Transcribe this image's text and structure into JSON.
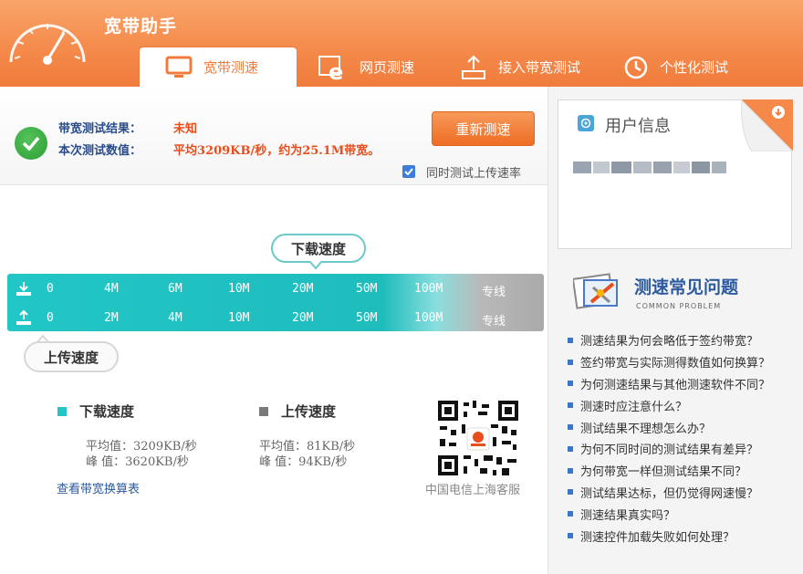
{
  "app": {
    "title": "宽带助手"
  },
  "tabs": [
    {
      "label": "宽带测速",
      "icon": "monitor-icon",
      "active": true
    },
    {
      "label": "网页测速",
      "icon": "browser-e-icon",
      "active": false
    },
    {
      "label": "接入带宽测试",
      "icon": "router-icon",
      "active": false
    },
    {
      "label": "个性化测试",
      "icon": "clock-icon",
      "active": false
    }
  ],
  "result": {
    "result_label": "带宽测试结果：",
    "result_value": "未知",
    "value_label": "本次测试数值：",
    "value_text": "平均3209KB/秒，约为25.1M带宽。",
    "retest_button": "重新测速",
    "upload_checkbox_label": "同时测试上传速率",
    "upload_checked": true
  },
  "speed_bar": {
    "download_label": "下载速度",
    "upload_label": "上传速度",
    "download_ticks": [
      "0",
      "4M",
      "6M",
      "10M",
      "20M",
      "50M",
      "100M",
      "专线"
    ],
    "upload_ticks": [
      "0",
      "2M",
      "4M",
      "10M",
      "20M",
      "50M",
      "100M",
      "专线"
    ]
  },
  "stats": {
    "download": {
      "title": "下载速度",
      "avg": "平均值：3209KB/秒",
      "peak": "峰  值：3620KB/秒",
      "color": "#22c6c6"
    },
    "upload": {
      "title": "上传速度",
      "avg": "平均值：81KB/秒",
      "peak": "峰  值：94KB/秒",
      "color": "#7a7a7a"
    },
    "link": "查看带宽换算表"
  },
  "qr": {
    "caption": "中国电信上海客服"
  },
  "user_info": {
    "title": "用户信息"
  },
  "faq": {
    "title": "测速常见问题",
    "subtitle": "COMMON PROBLEM",
    "items": [
      "测速结果为何会略低于签约带宽？",
      "签约带宽与实际测得数值如何换算？",
      "为何测速结果与其他测速软件不同？",
      "测速时应注意什么？",
      "测试结果不理想怎么办？",
      "为何不同时间的测试结果有差异？",
      "为何带宽一样但测试结果不同？",
      "测试结果达标，但仍觉得网速慢？",
      "测速结果真实吗？",
      "测速控件加载失败如何处理？"
    ]
  },
  "colors": {
    "accent": "#f07c3c",
    "teal": "#22c6c6",
    "link": "#2d5a9e"
  }
}
